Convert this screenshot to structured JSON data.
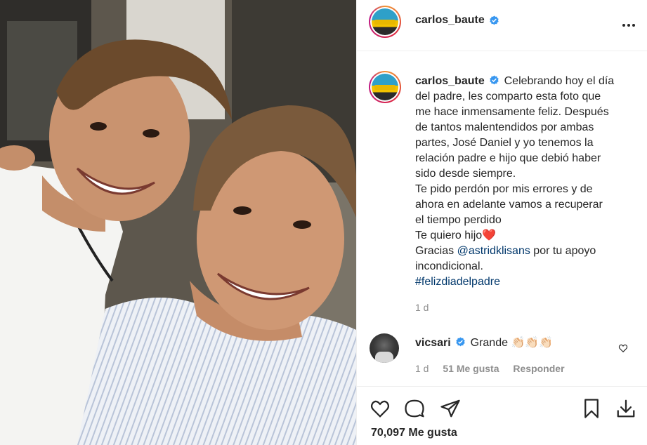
{
  "post": {
    "author": {
      "username": "carlos_baute",
      "verified": true
    },
    "caption_lines": [
      "Celebrando hoy el día",
      "del padre, les comparto esta foto que",
      "me hace inmensamente feliz. Después",
      "de tantos malentendidos por ambas",
      "partes, José Daniel y yo tenemos la",
      "relación padre e hijo que debió haber",
      "sido desde siempre.",
      "Te pido perdón por mis errores y de",
      "ahora en adelante vamos a recuperar",
      "el tiempo perdido",
      "Te quiero hijo❤️",
      "Gracias ",
      "@astridklisans",
      " por tu apoyo",
      "incondicional.",
      "#felizdiadelpadre"
    ],
    "time_ago": "1 d",
    "likes_label": "70,097 Me gusta"
  },
  "comment": {
    "username": "vicsari",
    "verified": true,
    "text": "Grande 👏🏻👏🏻👏🏻",
    "time_ago": "1 d",
    "likes": "51 Me gusta",
    "reply_label": "Responder"
  },
  "icons": {
    "more": "more-options-icon",
    "verified": "verified-badge-icon",
    "like": "heart-icon",
    "comment": "comment-bubble-icon",
    "share": "paper-plane-icon",
    "save": "bookmark-icon",
    "download": "download-icon"
  },
  "colors": {
    "verified_blue": "#3897f0",
    "link_blue": "#00376b",
    "meta_gray": "#8e8e8e",
    "heart_red": "#ed4956"
  }
}
